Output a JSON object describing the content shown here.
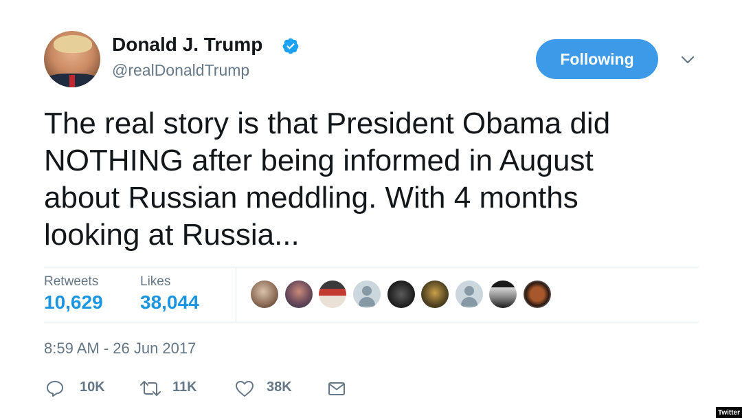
{
  "user": {
    "display_name": "Donald J. Trump",
    "handle": "@realDonaldTrump",
    "verified": true,
    "avatar_icon": "profile-photo"
  },
  "follow_button": {
    "label": "Following",
    "color": "#3d9ae8"
  },
  "tweet": {
    "text": "The real story is that President Obama did\nNOTHING after being informed in August\nabout Russian meddling. With 4 months\nlooking at Russia..."
  },
  "stats": {
    "retweets_label": "Retweets",
    "retweets_value": "10,629",
    "likes_label": "Likes",
    "likes_value": "38,044",
    "value_color": "#1b95e0"
  },
  "likers": [
    {
      "icon": "liker-avatar-photo"
    },
    {
      "icon": "liker-avatar-photo"
    },
    {
      "icon": "liker-avatar-photo"
    },
    {
      "icon": "default-profile-icon"
    },
    {
      "icon": "liker-avatar-photo"
    },
    {
      "icon": "liker-avatar-photo"
    },
    {
      "icon": "default-profile-icon"
    },
    {
      "icon": "liker-avatar-photo"
    },
    {
      "icon": "liker-avatar-photo"
    }
  ],
  "timestamp": "8:59 AM - 26 Jun 2017",
  "actions": {
    "reply_count": "10K",
    "retweet_count": "11K",
    "like_count": "38K",
    "reply_icon": "speech-bubble-icon",
    "retweet_icon": "retweet-arrows-icon",
    "like_icon": "heart-icon",
    "message_icon": "envelope-icon"
  },
  "watermark": "Twitter"
}
